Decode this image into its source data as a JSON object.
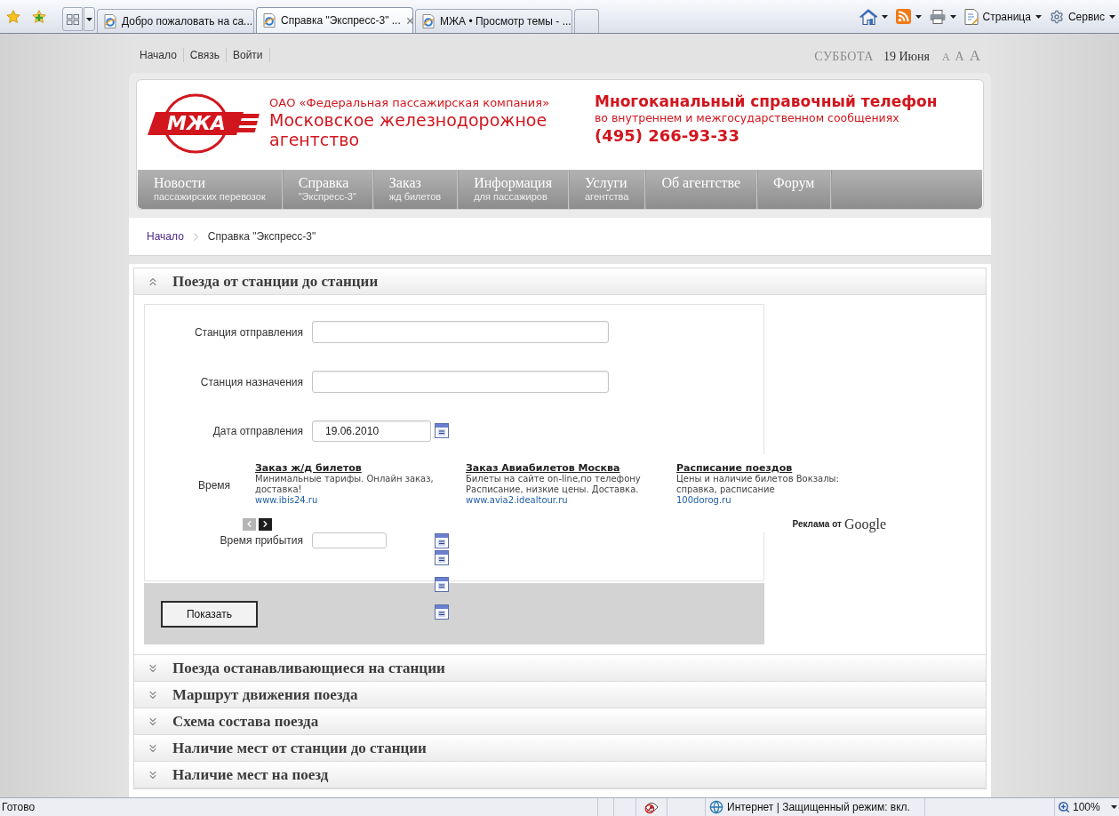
{
  "browser": {
    "tabs": [
      {
        "title": "Добро пожаловать на са...",
        "selected": false
      },
      {
        "title": "Справка \"Экспресс-3\" ...",
        "selected": true
      },
      {
        "title": "МЖА • Просмотр темы - ...",
        "selected": false
      }
    ],
    "commands": [
      {
        "kind": "home"
      },
      {
        "kind": "feeds"
      },
      {
        "kind": "print"
      },
      {
        "kind": "page",
        "label": "Страница"
      },
      {
        "kind": "tools",
        "label": "Сервис"
      }
    ]
  },
  "top_links": [
    "Начало",
    "Связь",
    "Войти"
  ],
  "date": {
    "weekday": "СУББОТА",
    "day": "19 Июня"
  },
  "text_size_controls": [
    "A",
    "A",
    "A"
  ],
  "header": {
    "logo": "МЖА",
    "company": "ОАО «Федеральная пассажирская компания»",
    "agency": "Московское железнодорожное агентство",
    "hotline": {
      "title": "Многоканальный справочный телефон",
      "subtitle": "во внутреннем и межгосударственном сообщениях",
      "phone": "(495) 266-93-33"
    }
  },
  "nav": [
    {
      "title": "Новости",
      "subtitle": "пассажирских перевозок"
    },
    {
      "title": "Справка",
      "subtitle": "\"Экспресс-3\""
    },
    {
      "title": "Заказ",
      "subtitle": "жд билетов"
    },
    {
      "title": "Информация",
      "subtitle": "для пассажиров"
    },
    {
      "title": "Услуги",
      "subtitle": "агентства"
    },
    {
      "title": "Об агентстве"
    },
    {
      "title": "Форум"
    }
  ],
  "breadcrumb": [
    "Начало",
    "Справка \"Экспресс-3\""
  ],
  "sections": [
    {
      "title": "Поезда от станции до станции",
      "expanded": true
    },
    {
      "title": "Поезда останавливающиеся на станции",
      "expanded": false
    },
    {
      "title": "Маршрут движения поезда",
      "expanded": false
    },
    {
      "title": "Схема состава поезда",
      "expanded": false
    },
    {
      "title": "Наличие мест от станции до станции",
      "expanded": false
    },
    {
      "title": "Наличие мест на поезд",
      "expanded": false
    }
  ],
  "form": {
    "fields": [
      {
        "kind": "text",
        "label": "Станция отправления"
      },
      {
        "kind": "text",
        "label": "Станция назначения"
      },
      {
        "kind": "date",
        "label": "Дата отправления",
        "value": "19.06.2010"
      },
      {
        "kind": "covered",
        "label": "Время"
      },
      {
        "kind": "time",
        "label": "Время прибытия"
      }
    ],
    "submit": "Показать"
  },
  "ads": {
    "items": [
      {
        "title": "Заказ ж/д билетов",
        "text": "Минимальные тарифы. Онлайн заказ, доставка!",
        "url": "www.ibis24.ru"
      },
      {
        "title": "Заказ Авиабилетов Москва",
        "text": "Билеты на сайте on-line,по телефону Расписание, низкие цены. Доставка.",
        "url": "www.avia2.idealtour.ru"
      },
      {
        "title": "Расписание поездов",
        "text": "Цены и наличие билетов Вокзалы: справка, расписание",
        "url": "100dorog.ru"
      }
    ],
    "attribution": "Реклама от",
    "logo": "Google"
  },
  "status_bar": {
    "text": "Готово",
    "zone": "Интернет | Защищенный режим: вкл.",
    "zoom": "100%"
  }
}
